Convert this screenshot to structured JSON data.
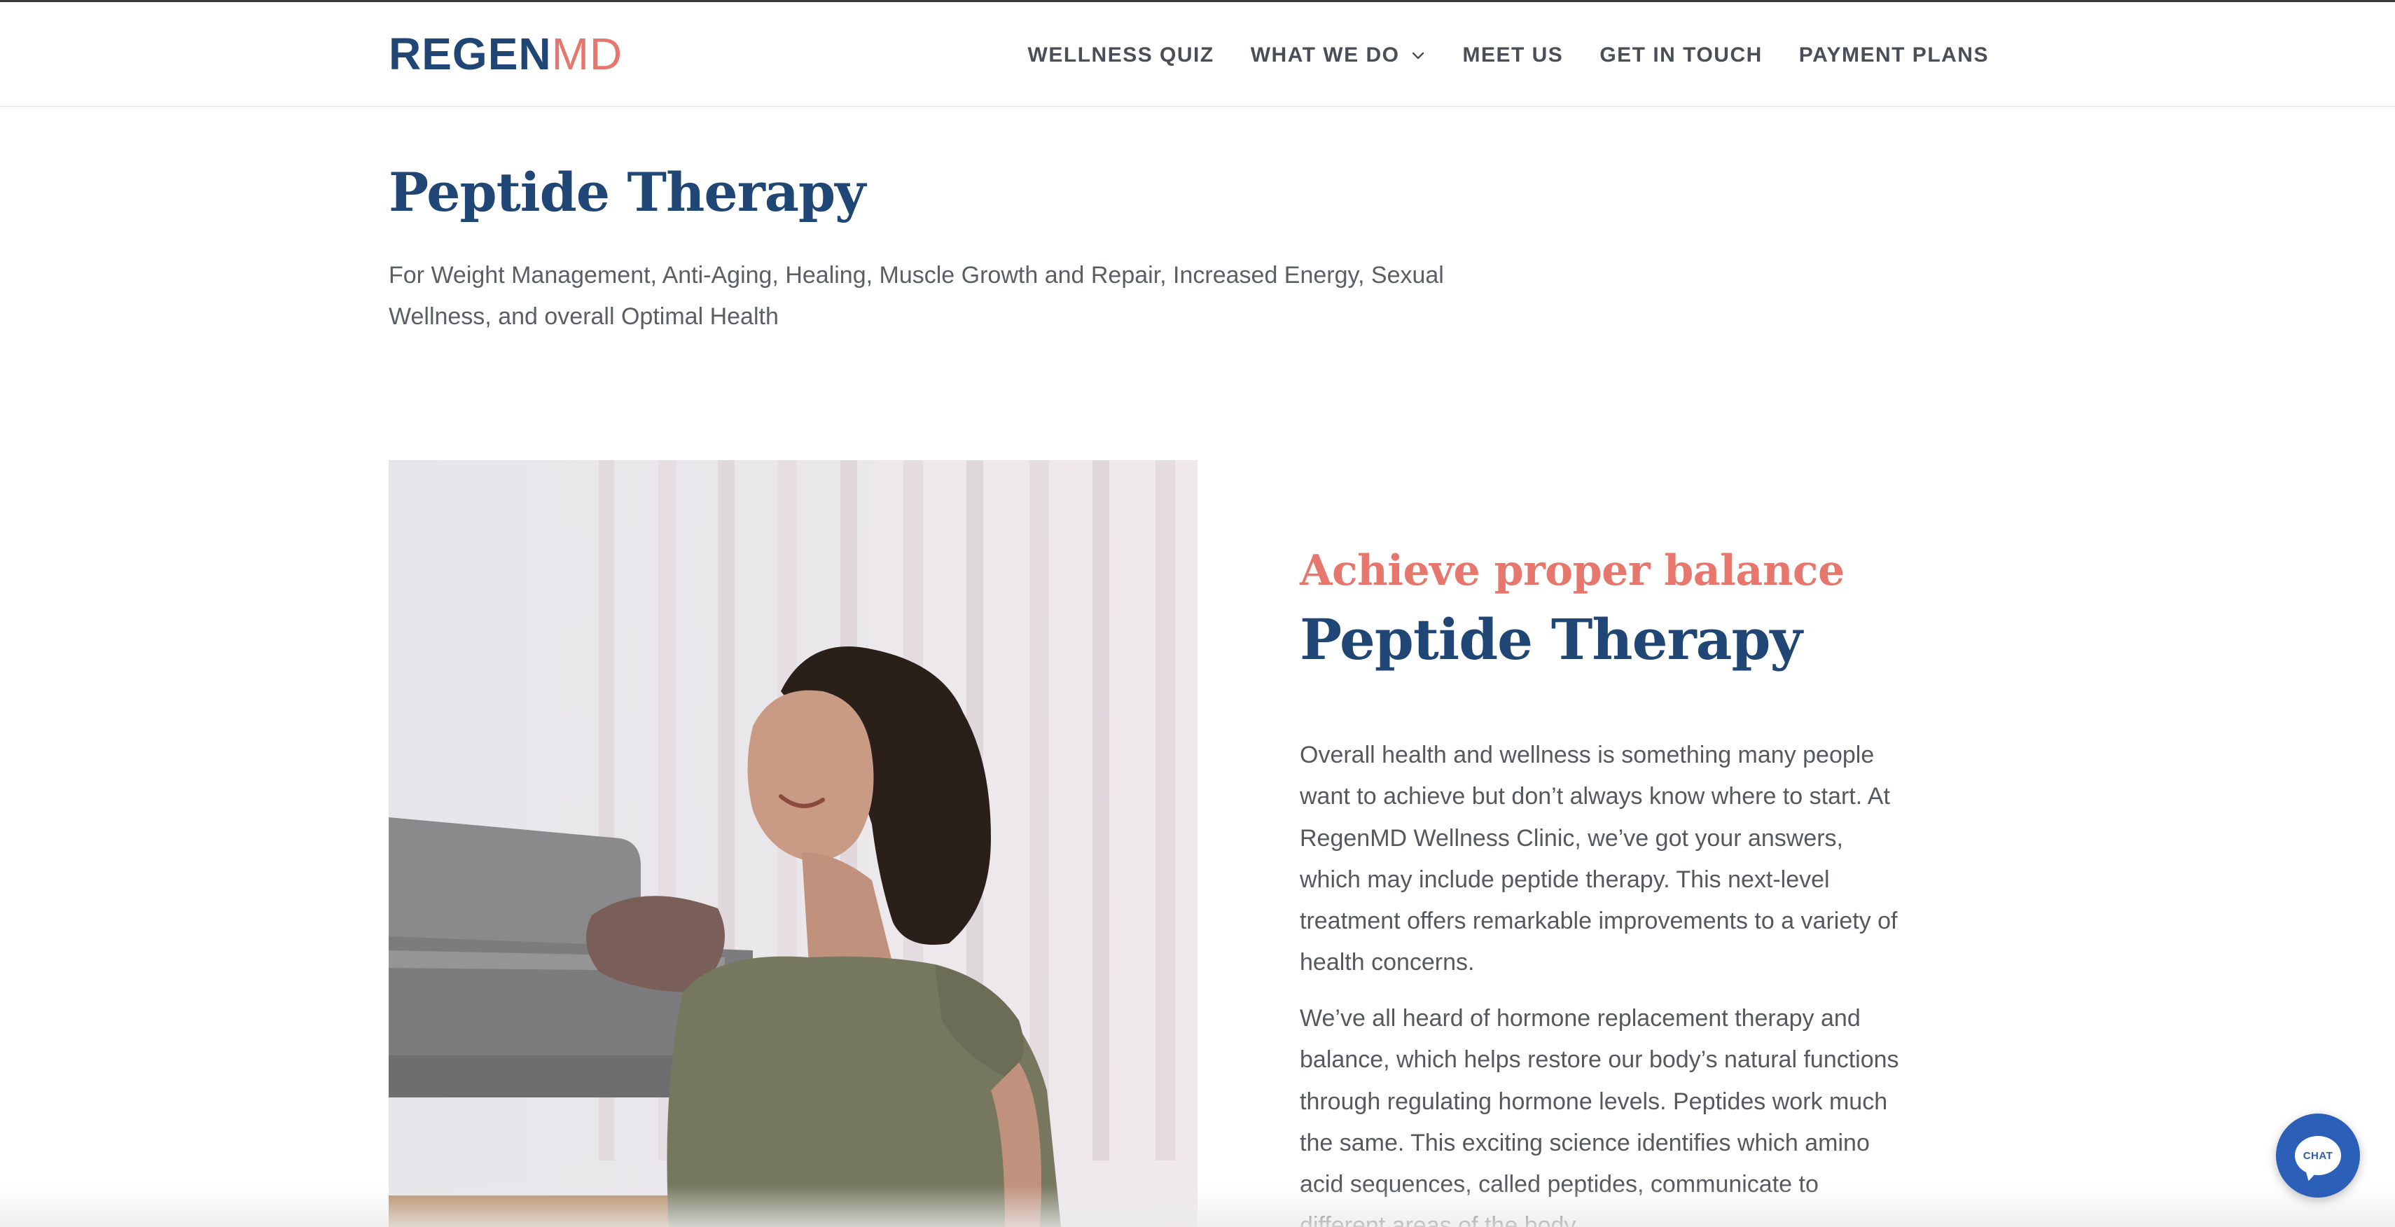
{
  "brand": {
    "logo_primary": "REGEN",
    "logo_secondary": "MD",
    "primary_color": "#1f4675",
    "accent_color": "#e7776d"
  },
  "nav": {
    "items": [
      {
        "label": "WELLNESS QUIZ"
      },
      {
        "label": "WHAT WE DO",
        "icon": "chevron-down-icon"
      },
      {
        "label": "MEET US"
      },
      {
        "label": "GET IN TOUCH"
      },
      {
        "label": "PAYMENT PLANS"
      }
    ]
  },
  "hero": {
    "title": "Peptide Therapy",
    "subtitle": "For Weight Management, Anti-Aging, Healing, Muscle Growth and Repair, Increased Energy, Sexual Wellness, and overall Optimal Health"
  },
  "section": {
    "eyebrow": "Achieve proper balance",
    "title": "Peptide Therapy",
    "paragraphs": [
      "Overall health and wellness is something many people want to achieve but don’t always know where to start. At RegenMD Wellness Clinic, we’ve got your answers, which may include peptide therapy. This next-level treatment offers remarkable improvements to a variety of health concerns.",
      "We’ve all heard of hormone replacement therapy and balance, which helps restore our body’s natural functions through regulating hormone levels. Peptides work much the same. This exciting science identifies which amino acid sequences, called peptides, communicate to different areas of the body"
    ]
  },
  "chat": {
    "label": "CHAT",
    "color": "#2b5fb8"
  }
}
